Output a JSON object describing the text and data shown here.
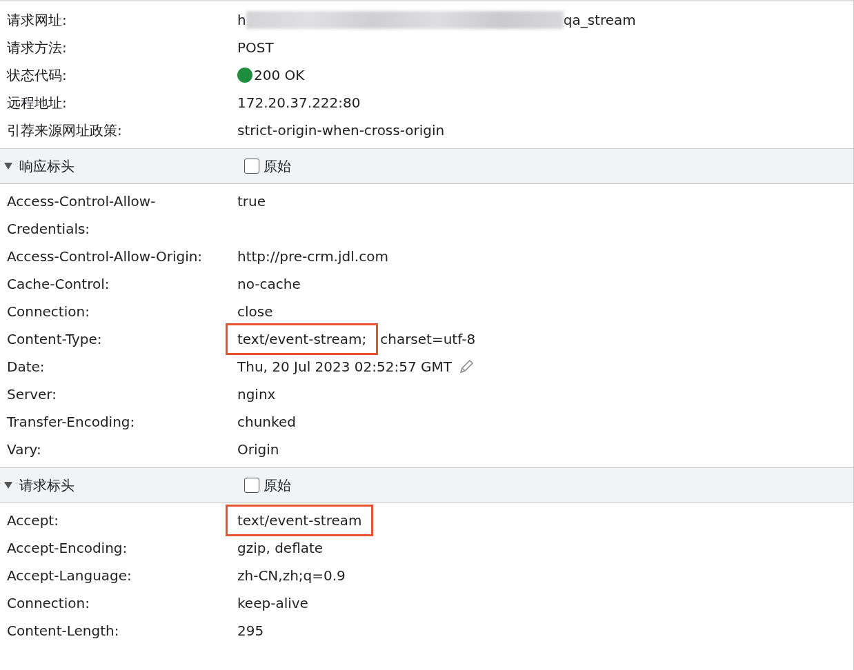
{
  "general": [
    {
      "name": "请求网址:",
      "value": "h",
      "value_tail": "qa_stream",
      "redacted": true
    },
    {
      "name": "请求方法:",
      "value": "POST"
    },
    {
      "name": "状态代码:",
      "value": "200 OK",
      "color": "#1e8e3e"
    },
    {
      "name": "远程地址:",
      "value": "172.20.37.222:80"
    },
    {
      "name": "引荐来源网址政策:",
      "value": "strict-origin-when-cross-origin"
    }
  ],
  "sections": [
    {
      "title": "响应标头",
      "expanded": true,
      "raw_label": "原始",
      "raw_checked": false,
      "rows": [
        {
          "name": "Access-Control-Allow-Credentials:",
          "value": "true"
        },
        {
          "name": "Access-Control-Allow-Origin:",
          "value": "http://pre-crm.jdl.com"
        },
        {
          "name": "Cache-Control:",
          "value": "no-cache"
        },
        {
          "name": "Connection:",
          "value": "close"
        },
        {
          "name": "Content-Type:",
          "value": "text/event-stream;",
          "value_tail": "charset=utf-8",
          "highlighted": true
        },
        {
          "name": "Date:",
          "value": "Thu, 20 Jul 2023 02:52:57 GMT",
          "editable": true
        },
        {
          "name": "Server:",
          "value": "nginx"
        },
        {
          "name": "Transfer-Encoding:",
          "value": "chunked"
        },
        {
          "name": "Vary:",
          "value": "Origin"
        }
      ]
    },
    {
      "title": "请求标头",
      "expanded": true,
      "raw_label": "原始",
      "raw_checked": false,
      "rows": [
        {
          "name": "Accept:",
          "value": "text/event-stream",
          "highlighted": true
        },
        {
          "name": "Accept-Encoding:",
          "value": "gzip, deflate"
        },
        {
          "name": "Accept-Language:",
          "value": "zh-CN,zh;q=0.9"
        },
        {
          "name": "Connection:",
          "value": "keep-alive"
        },
        {
          "name": "Content-Length:",
          "value": "295"
        }
      ]
    }
  ]
}
